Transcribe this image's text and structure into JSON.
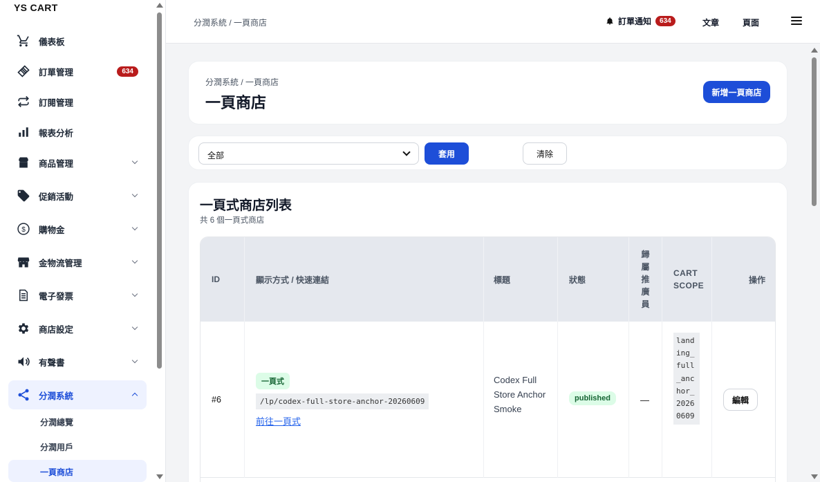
{
  "brand": "YS CART",
  "sidebar": {
    "items": [
      {
        "label": "儀表板"
      },
      {
        "label": "訂單管理",
        "badge": "634"
      },
      {
        "label": "訂閱管理"
      },
      {
        "label": "報表分析"
      },
      {
        "label": "商品管理"
      },
      {
        "label": "促銷活動"
      },
      {
        "label": "購物金"
      },
      {
        "label": "金物流管理"
      },
      {
        "label": "電子發票"
      },
      {
        "label": "商店設定"
      },
      {
        "label": "有聲書"
      },
      {
        "label": "分潤系統"
      }
    ],
    "sub_items": [
      {
        "label": "分潤總覽"
      },
      {
        "label": "分潤用戶"
      },
      {
        "label": "一頁商店"
      }
    ]
  },
  "topbar": {
    "breadcrumb": "分潤系統 / 一頁商店",
    "notif_label": "訂單通知",
    "notif_count": "634",
    "articles": "文章",
    "pages": "頁面"
  },
  "header": {
    "breadcrumb": "分潤系統 / 一頁商店",
    "title": "一頁商店",
    "add_button": "新增一頁商店"
  },
  "filter": {
    "selected": "全部",
    "apply": "套用",
    "clear": "清除"
  },
  "list": {
    "title": "一頁式商店列表",
    "subtitle": "共 6 個一頁式商店",
    "columns": {
      "id": "ID",
      "display": "顯示方式 / 快速連結",
      "title": "標題",
      "status": "狀態",
      "promoter": "歸屬推廣員",
      "scope": "CART SCOPE",
      "actions": "操作"
    },
    "rows": [
      {
        "id": "#6",
        "type": "一頁式",
        "path": "/lp/codex-full-store-anchor-20260609",
        "link": "前往一頁式",
        "title": "Codex Full Store Anchor Smoke",
        "status": "published",
        "promoter": "—",
        "scope": "landing_full_anchor_20260609",
        "edit": "編輯"
      }
    ]
  },
  "colors": {
    "primary": "#1d4ed8",
    "badge": "#b91c1c",
    "status_bg": "#dcfce7",
    "status_text": "#166534"
  }
}
